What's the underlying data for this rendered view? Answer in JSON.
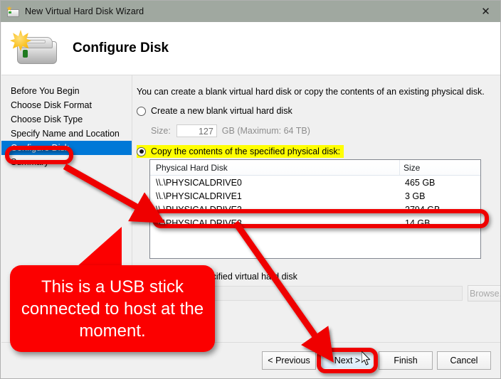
{
  "window": {
    "title": "New Virtual Hard Disk Wizard",
    "icon": "virtual-disk-icon",
    "close_label": "✕",
    "titlebar_color": "#a0a8a0"
  },
  "header": {
    "page_title": "Configure Disk",
    "icon": "new-hard-disk-icon"
  },
  "sidebar": {
    "items": [
      {
        "label": "Before You Begin",
        "selected": false
      },
      {
        "label": "Choose Disk Format",
        "selected": false
      },
      {
        "label": "Choose Disk Type",
        "selected": false
      },
      {
        "label": "Specify Name and Location",
        "selected": false
      },
      {
        "label": "Configure Disk",
        "selected": true
      },
      {
        "label": "Summary",
        "selected": false
      }
    ],
    "selected_color": "#0078d7"
  },
  "main": {
    "intro": "You can create a blank virtual hard disk or copy the contents of an existing physical disk.",
    "option_blank": {
      "label": "Create a new blank virtual hard disk",
      "checked": false
    },
    "size_field": {
      "label": "Size:",
      "value": "127",
      "suffix": "GB (Maximum: 64 TB)"
    },
    "option_copy": {
      "label": "Copy the contents of the specified physical disk:",
      "checked": true,
      "highlight_color": "#ffff00"
    },
    "disk_table": {
      "columns": [
        "Physical Hard Disk",
        "Size"
      ],
      "rows": [
        {
          "disk": "\\\\.\\PHYSICALDRIVE0",
          "size": "465 GB"
        },
        {
          "disk": "\\\\.\\PHYSICALDRIVE1",
          "size": "3 GB"
        },
        {
          "disk": "\\\\.\\PHYSICALDRIVE2",
          "size": "2794 GB"
        },
        {
          "disk": "\\\\.\\PHYSICALDRIVE3",
          "size": "14 GB"
        }
      ]
    },
    "location": {
      "label": "Location of the specified virtual hard disk",
      "value": "",
      "browse_label": "Browse..."
    }
  },
  "footer": {
    "previous": "< Previous",
    "next": "Next >",
    "finish": "Finish",
    "cancel": "Cancel"
  },
  "annotations": {
    "callout_text": "This is a USB stick connected to host at the moment.",
    "accent_color": "#ef0000",
    "highlights": [
      "sidebar-configure-disk",
      "physicaldrive3-row",
      "next-button"
    ]
  }
}
